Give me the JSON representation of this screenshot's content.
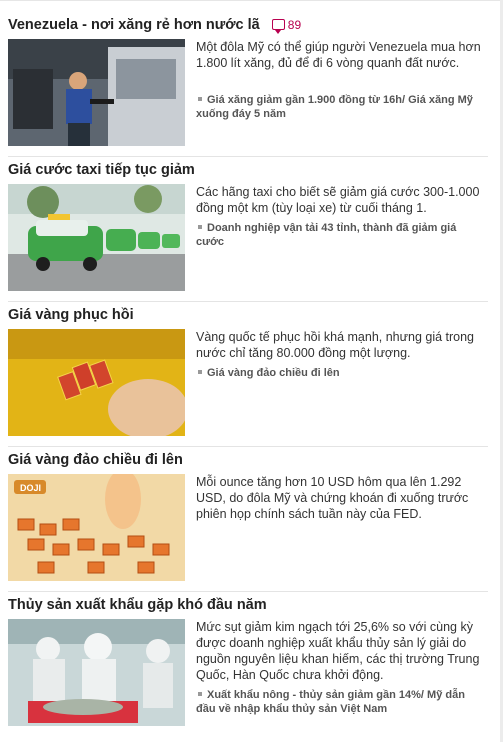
{
  "articles": [
    {
      "title": "Venezuela - nơi xăng rẻ hơn nước lã",
      "comments": "89",
      "description": "Một đôla Mỹ có thể giúp người Venezuela mua hơn 1.800 lít xăng, đủ để đi 6 vòng quanh đất nước.",
      "related": "Giá xăng giảm gần 1.900 đồng từ 16h/ Giá xăng Mỹ xuống đáy 5 năm"
    },
    {
      "title": "Giá cước taxi tiếp tục giảm",
      "description": "Các hãng taxi cho biết sẽ giảm giá cước 300-1.000 đồng một km (tùy loại xe) từ cuối tháng 1.",
      "related": "Doanh nghiệp vận tải 43 tỉnh, thành đã giảm giá cước"
    },
    {
      "title": "Giá vàng phục hồi",
      "description": "Vàng quốc tế phục hồi khá mạnh, nhưng giá trong nước chỉ tăng 80.000 đồng một lượng.",
      "related": "Giá vàng đảo chiều đi lên"
    },
    {
      "title": "Giá vàng đảo chiều đi lên",
      "description": "Mỗi ounce tăng hơn 10 USD hôm qua lên 1.292 USD, do đôla Mỹ và chứng khoán đi xuống trước phiên họp chính sách tuần này của FED."
    },
    {
      "title": "Thủy sản xuất khẩu gặp khó đầu năm",
      "description": "Mức sụt giảm kim ngạch tới 25,6% so với cùng kỳ được doanh nghiệp xuất khẩu thủy sản lý giải do nguồn nguyên liệu khan hiếm, các thị trường Trung Quốc, Hàn Quốc chưa khởi động.",
      "related": "Xuất khẩu nông - thủy sản giảm gần 14%/ Mỹ dẫn đầu về nhập khẩu thủy sản Việt Nam"
    }
  ],
  "thumbnail_brand": "DOJI"
}
